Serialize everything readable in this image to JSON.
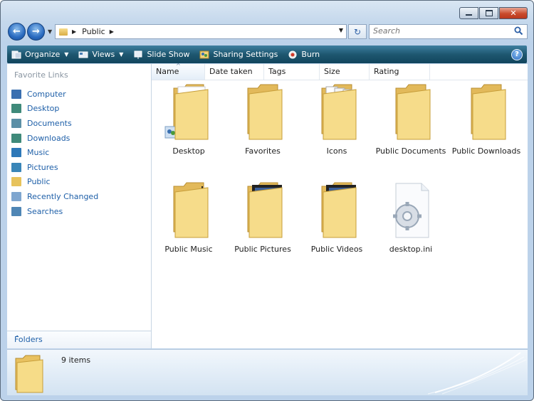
{
  "address": {
    "current": "Public"
  },
  "search": {
    "placeholder": "Search"
  },
  "toolbar": {
    "organize": "Organize",
    "views": "Views",
    "slideshow": "Slide Show",
    "sharing": "Sharing Settings",
    "burn": "Burn"
  },
  "sidebar": {
    "title": "Favorite Links",
    "items": [
      {
        "label": "Computer",
        "icon": "computer-icon"
      },
      {
        "label": "Desktop",
        "icon": "desktop-icon"
      },
      {
        "label": "Documents",
        "icon": "documents-icon"
      },
      {
        "label": "Downloads",
        "icon": "downloads-icon"
      },
      {
        "label": "Music",
        "icon": "music-icon"
      },
      {
        "label": "Pictures",
        "icon": "pictures-icon"
      },
      {
        "label": "Public",
        "icon": "folder-icon"
      },
      {
        "label": "Recently Changed",
        "icon": "recent-icon"
      },
      {
        "label": "Searches",
        "icon": "searches-icon"
      }
    ],
    "folders_label": "Folders"
  },
  "columns": [
    "Name",
    "Date taken",
    "Tags",
    "Size",
    "Rating"
  ],
  "files": [
    {
      "label": "Desktop",
      "icon": "desktop-folder-icon"
    },
    {
      "label": "Favorites",
      "icon": "folder-icon"
    },
    {
      "label": "Icons",
      "icon": "folder-with-documents-icon"
    },
    {
      "label": "Public Documents",
      "icon": "documents-folder-icon"
    },
    {
      "label": "Public Downloads",
      "icon": "folder-icon"
    },
    {
      "label": "Public Music",
      "icon": "music-folder-icon"
    },
    {
      "label": "Public Pictures",
      "icon": "pictures-folder-icon"
    },
    {
      "label": "Public Videos",
      "icon": "videos-folder-icon"
    },
    {
      "label": "desktop.ini",
      "icon": "settings-file-icon"
    }
  ],
  "status": {
    "count": "9 items"
  }
}
